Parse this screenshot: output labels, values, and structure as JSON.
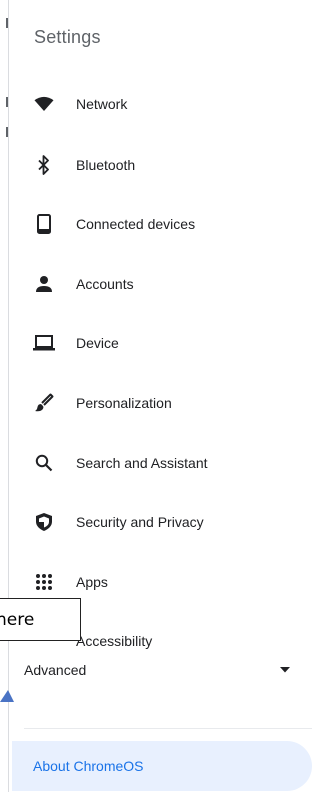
{
  "title": "Settings",
  "nav_items": [
    {
      "label": "Network",
      "icon": "wifi-icon"
    },
    {
      "label": "Bluetooth",
      "icon": "bluetooth-icon"
    },
    {
      "label": "Connected devices",
      "icon": "phone-icon"
    },
    {
      "label": "Accounts",
      "icon": "person-icon"
    },
    {
      "label": "Device",
      "icon": "laptop-icon"
    },
    {
      "label": "Personalization",
      "icon": "brush-icon"
    },
    {
      "label": "Search and Assistant",
      "icon": "search-icon"
    },
    {
      "label": "Security and Privacy",
      "icon": "shield-icon"
    },
    {
      "label": "Apps",
      "icon": "apps-grid-icon"
    },
    {
      "label": "Accessibility",
      "icon": "accessibility-icon"
    }
  ],
  "advanced": {
    "label": "Advanced",
    "icon": "caret-down-icon"
  },
  "about": {
    "label": "About ChromeOS"
  },
  "callout": {
    "text": "here"
  },
  "colors": {
    "accent": "#1a73e8",
    "selected_bg": "#e8f0fe",
    "text": "#202124",
    "icon": "#202124"
  }
}
